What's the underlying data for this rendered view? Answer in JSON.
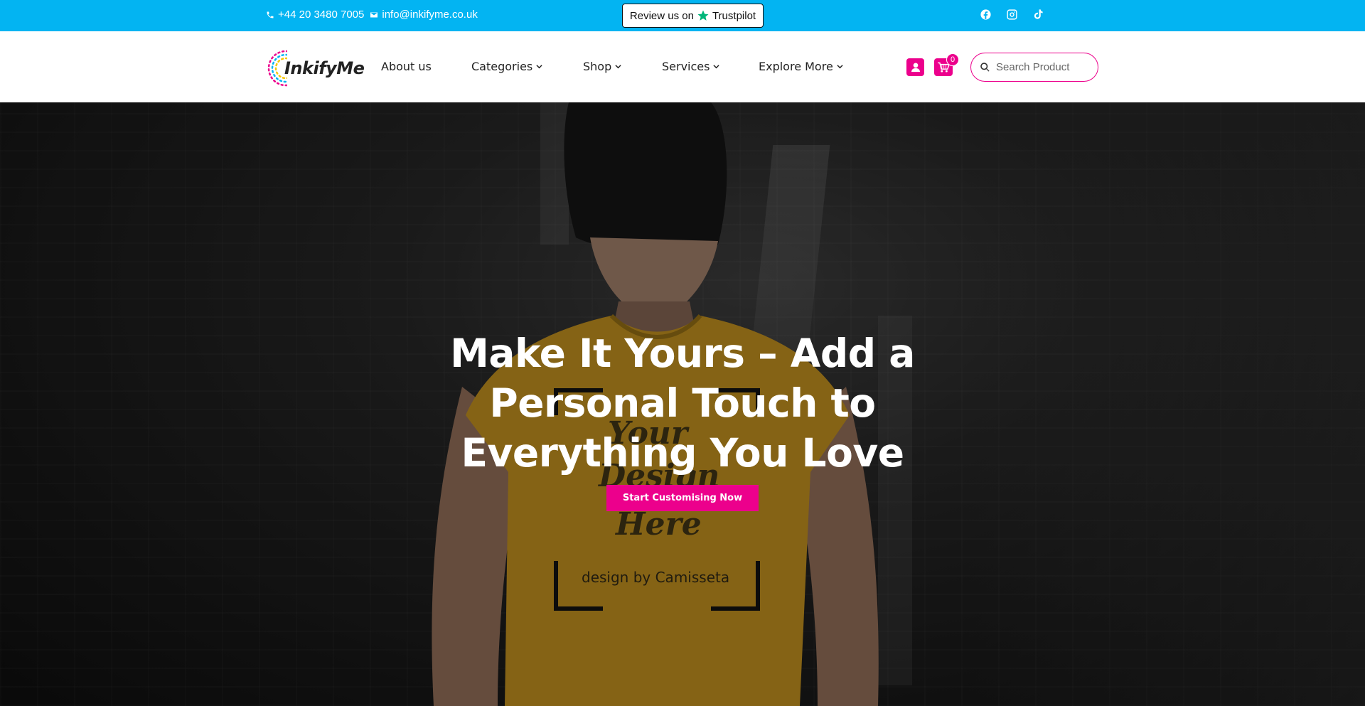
{
  "topbar": {
    "phone": "+44 20 3480 7005",
    "email": "info@inkifyme.co.uk",
    "review_prefix": "Review us on",
    "review_brand": "Trustpilot",
    "socials": [
      "facebook-icon",
      "instagram-icon",
      "tiktok-icon"
    ]
  },
  "header": {
    "logo_text": "InkifyMe",
    "nav": [
      {
        "label": "About us",
        "has_dropdown": false
      },
      {
        "label": "Categories",
        "has_dropdown": true
      },
      {
        "label": "Shop",
        "has_dropdown": true
      },
      {
        "label": "Services",
        "has_dropdown": true
      },
      {
        "label": "Explore More",
        "has_dropdown": true
      }
    ],
    "cart_count": "0",
    "search_placeholder": "Search Product"
  },
  "hero": {
    "title": "Make It Yours – Add a Personal Touch to Everything You Love",
    "cta_label": "Start Customising Now",
    "shirt_line1": "Your",
    "shirt_line2": "Design",
    "shirt_line3": "Here",
    "shirt_credit": "design by Camisseta"
  },
  "colors": {
    "topbar_bg": "#03b4f2",
    "accent": "#ec008c",
    "shirt": "#b98a1e",
    "trustpilot_star": "#00b67a"
  }
}
